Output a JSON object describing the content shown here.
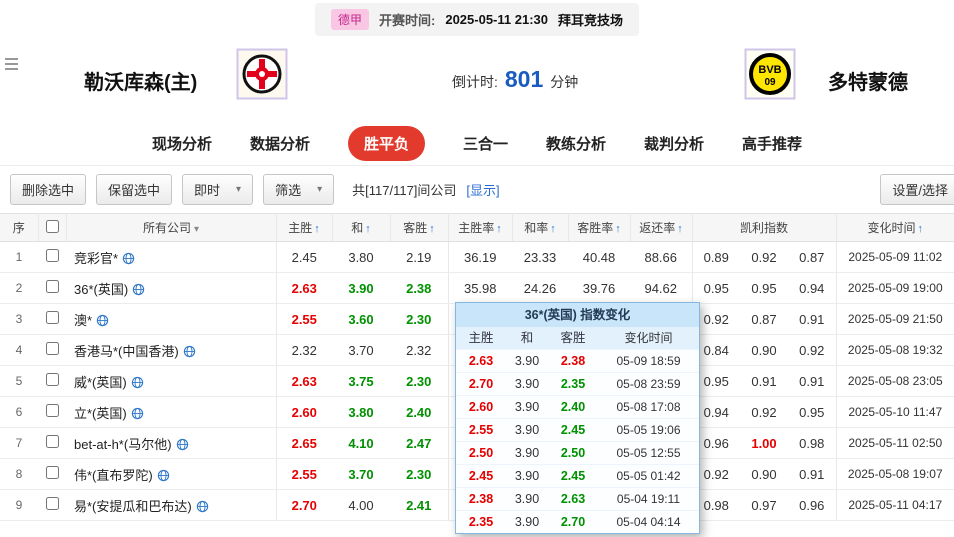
{
  "topbar": {
    "league": "德甲",
    "kickoff_label": "开赛时间:",
    "kickoff_time": "2025-05-11 21:30",
    "venue": "拜耳竞技场"
  },
  "teams": {
    "home_name": "勒沃库森(主)",
    "away_name": "多特蒙德",
    "away_logo_text": "BVB",
    "away_logo_year": "09",
    "countdown_label": "倒计时:",
    "countdown_value": "801",
    "countdown_unit": "分钟"
  },
  "tabs": [
    {
      "id": "live-analysis",
      "label": "现场分析",
      "active": false
    },
    {
      "id": "data-analysis",
      "label": "数据分析",
      "active": false
    },
    {
      "id": "win-draw-lose",
      "label": "胜平负",
      "active": true
    },
    {
      "id": "three-in-one",
      "label": "三合一",
      "active": false
    },
    {
      "id": "coach-analysis",
      "label": "教练分析",
      "active": false
    },
    {
      "id": "referee-analysis",
      "label": "裁判分析",
      "active": false
    },
    {
      "id": "expert-recommend",
      "label": "高手推荐",
      "active": false
    }
  ],
  "toolbar": {
    "delete_selected": "删除选中",
    "keep_selected": "保留选中",
    "instant": "即时",
    "filter": "筛选",
    "count_text": "共[117/117]间公司",
    "show_link": "[显示]",
    "settings": "设置/选择"
  },
  "table": {
    "headers": {
      "seq": "序",
      "company": "所有公司",
      "home": "主胜",
      "draw": "和",
      "away": "客胜",
      "home_rate": "主胜率",
      "draw_rate": "和率",
      "away_rate": "客胜率",
      "return_rate": "返还率",
      "kelly": "凯利指数",
      "time": "变化时间"
    },
    "rows": [
      {
        "seq": "1",
        "company": "竞彩官*",
        "odds": [
          "2.45",
          "3.80",
          "2.19"
        ],
        "odds_trend": [
          "flat",
          "flat",
          "flat"
        ],
        "rates": [
          "36.19",
          "23.33",
          "40.48",
          "88.66"
        ],
        "kelly": [
          "0.89",
          "0.92",
          "0.87"
        ],
        "kelly_trend": [
          "flat",
          "flat",
          "flat"
        ],
        "time": "2025-05-09 11:02"
      },
      {
        "seq": "2",
        "company": "36*(英国)",
        "odds": [
          "2.63",
          "3.90",
          "2.38"
        ],
        "odds_trend": [
          "up",
          "down",
          "down"
        ],
        "rates": [
          "35.98",
          "24.26",
          "39.76",
          "94.62"
        ],
        "kelly": [
          "0.95",
          "0.95",
          "0.94"
        ],
        "kelly_trend": [
          "flat",
          "flat",
          "flat"
        ],
        "time": "2025-05-09 19:00"
      },
      {
        "seq": "3",
        "company": "澳*",
        "odds": [
          "2.55",
          "3.60",
          "2.30"
        ],
        "odds_trend": [
          "up",
          "down",
          "down"
        ],
        "rates": [
          "",
          "",
          "",
          ""
        ],
        "kelly": [
          "0.92",
          "0.87",
          "0.91"
        ],
        "kelly_trend": [
          "flat",
          "flat",
          "flat"
        ],
        "time": "2025-05-09 21:50"
      },
      {
        "seq": "4",
        "company": "香港马*(中国香港)",
        "odds": [
          "2.32",
          "3.70",
          "2.32"
        ],
        "odds_trend": [
          "flat",
          "flat",
          "flat"
        ],
        "rates": [
          "",
          "",
          "",
          ""
        ],
        "kelly": [
          "0.84",
          "0.90",
          "0.92"
        ],
        "kelly_trend": [
          "flat",
          "flat",
          "flat"
        ],
        "time": "2025-05-08 19:32"
      },
      {
        "seq": "5",
        "company": "威*(英国)",
        "odds": [
          "2.63",
          "3.75",
          "2.30"
        ],
        "odds_trend": [
          "up",
          "down",
          "down"
        ],
        "rates": [
          "",
          "",
          "",
          ""
        ],
        "kelly": [
          "0.95",
          "0.91",
          "0.91"
        ],
        "kelly_trend": [
          "flat",
          "flat",
          "flat"
        ],
        "time": "2025-05-08 23:05"
      },
      {
        "seq": "6",
        "company": "立*(英国)",
        "odds": [
          "2.60",
          "3.80",
          "2.40"
        ],
        "odds_trend": [
          "up",
          "down",
          "down"
        ],
        "rates": [
          "",
          "",
          "",
          ""
        ],
        "kelly": [
          "0.94",
          "0.92",
          "0.95"
        ],
        "kelly_trend": [
          "flat",
          "flat",
          "flat"
        ],
        "time": "2025-05-10 11:47"
      },
      {
        "seq": "7",
        "company": "bet-at-h*(马尔他)",
        "odds": [
          "2.65",
          "4.10",
          "2.47"
        ],
        "odds_trend": [
          "up",
          "down",
          "down"
        ],
        "rates": [
          "",
          "",
          "",
          ""
        ],
        "kelly": [
          "0.96",
          "1.00",
          "0.98"
        ],
        "kelly_trend": [
          "flat",
          "up",
          "flat"
        ],
        "time": "2025-05-11 02:50"
      },
      {
        "seq": "8",
        "company": "伟*(直布罗陀)",
        "odds": [
          "2.55",
          "3.70",
          "2.30"
        ],
        "odds_trend": [
          "up",
          "down",
          "down"
        ],
        "rates": [
          "",
          "",
          "",
          ""
        ],
        "kelly": [
          "0.92",
          "0.90",
          "0.91"
        ],
        "kelly_trend": [
          "flat",
          "flat",
          "flat"
        ],
        "time": "2025-05-08 19:07"
      },
      {
        "seq": "9",
        "company": "易*(安提瓜和巴布达)",
        "odds": [
          "2.70",
          "4.00",
          "2.41"
        ],
        "odds_trend": [
          "up",
          "flat",
          "down"
        ],
        "rates": [
          "",
          "",
          "",
          ""
        ],
        "kelly": [
          "0.98",
          "0.97",
          "0.96"
        ],
        "kelly_trend": [
          "flat",
          "flat",
          "flat"
        ],
        "time": "2025-05-11 04:17"
      }
    ]
  },
  "popup": {
    "title": "36*(英国) 指数变化",
    "headers": [
      "主胜",
      "和",
      "客胜",
      "变化时间"
    ],
    "rows": [
      {
        "values": [
          "2.63",
          "3.90",
          "2.38"
        ],
        "trend": [
          "up",
          "flat",
          "up"
        ],
        "time": "05-09 18:59"
      },
      {
        "values": [
          "2.70",
          "3.90",
          "2.35"
        ],
        "trend": [
          "up",
          "flat",
          "down"
        ],
        "time": "05-08 23:59"
      },
      {
        "values": [
          "2.60",
          "3.90",
          "2.40"
        ],
        "trend": [
          "up",
          "flat",
          "down"
        ],
        "time": "05-08 17:08"
      },
      {
        "values": [
          "2.55",
          "3.90",
          "2.45"
        ],
        "trend": [
          "up",
          "flat",
          "down"
        ],
        "time": "05-05 19:06"
      },
      {
        "values": [
          "2.50",
          "3.90",
          "2.50"
        ],
        "trend": [
          "up",
          "flat",
          "down"
        ],
        "time": "05-05 12:55"
      },
      {
        "values": [
          "2.45",
          "3.90",
          "2.45"
        ],
        "trend": [
          "up",
          "flat",
          "down"
        ],
        "time": "05-05 01:42"
      },
      {
        "values": [
          "2.38",
          "3.90",
          "2.63"
        ],
        "trend": [
          "up",
          "flat",
          "down"
        ],
        "time": "05-04 19:11"
      },
      {
        "values": [
          "2.35",
          "3.90",
          "2.70"
        ],
        "trend": [
          "up",
          "flat",
          "down"
        ],
        "time": "05-04 04:14"
      }
    ]
  },
  "colors": {
    "accent": "#e23b2e",
    "odds_up": "#e60000",
    "odds_down": "#009100",
    "link": "#2b6cd4",
    "countdown": "#1a5bbf"
  }
}
